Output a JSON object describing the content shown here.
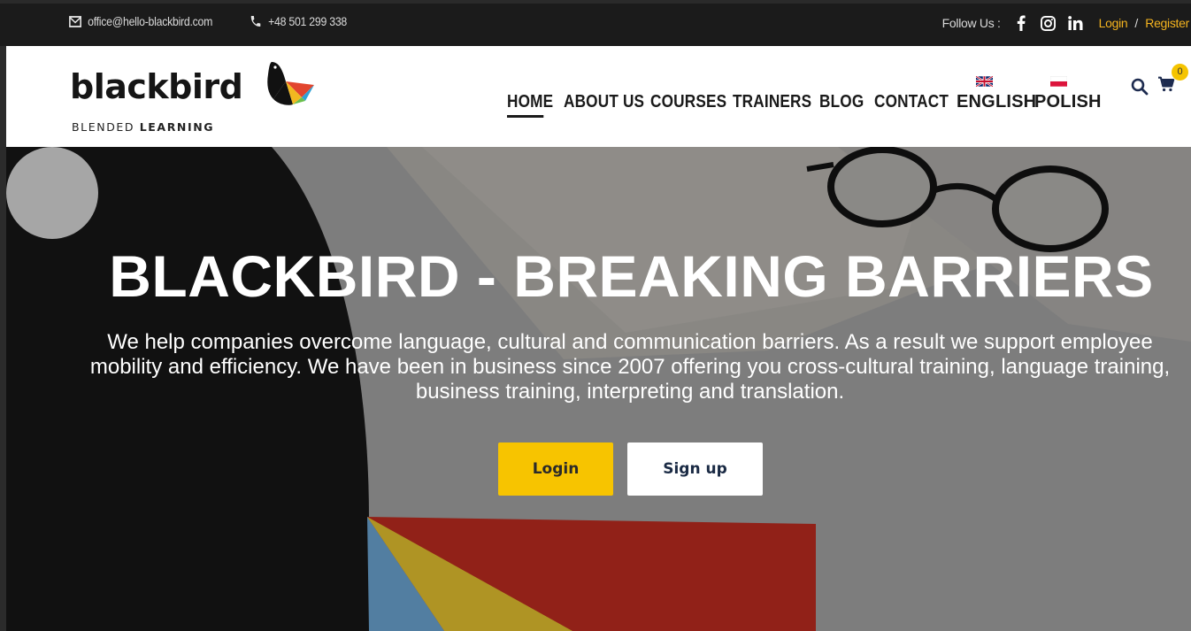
{
  "topbar": {
    "email": "office@hello-blackbird.com",
    "phone": "+48 501 299 338",
    "follow_label": "Follow Us :",
    "social_icons": [
      "facebook-icon",
      "instagram-icon",
      "linkedin-icon"
    ],
    "login_label": "Login",
    "separator": "/",
    "register_label": "Register"
  },
  "header": {
    "logo_word": "blackbird",
    "logo_tag_light": "BLENDED ",
    "logo_tag_bold": "LEARNING",
    "nav": [
      {
        "label": "HOME",
        "active": true
      },
      {
        "label": "ABOUT US"
      },
      {
        "label": "COURSES"
      },
      {
        "label": "TRAINERS"
      },
      {
        "label": "BLOG"
      },
      {
        "label": "CONTACT"
      },
      {
        "label": "ENGLISH",
        "flag": "uk-flag-icon"
      },
      {
        "label": "POLISH",
        "flag": "poland-flag-icon"
      }
    ],
    "cart_count": "0"
  },
  "hero": {
    "title": "BLACKBIRD - BREAKING BARRIERS",
    "text": "We help companies overcome language, cultural and communication barriers. As a result we support employee mobility and efficiency. We have been in business since 2007 offering you cross-cultural training, language training, business training, interpreting and translation.",
    "login_button": "Login",
    "signup_button": "Sign up"
  },
  "colors": {
    "accent": "#f7c400",
    "link_orange": "#f5b41f",
    "topbar_bg": "#1b1b1b"
  }
}
